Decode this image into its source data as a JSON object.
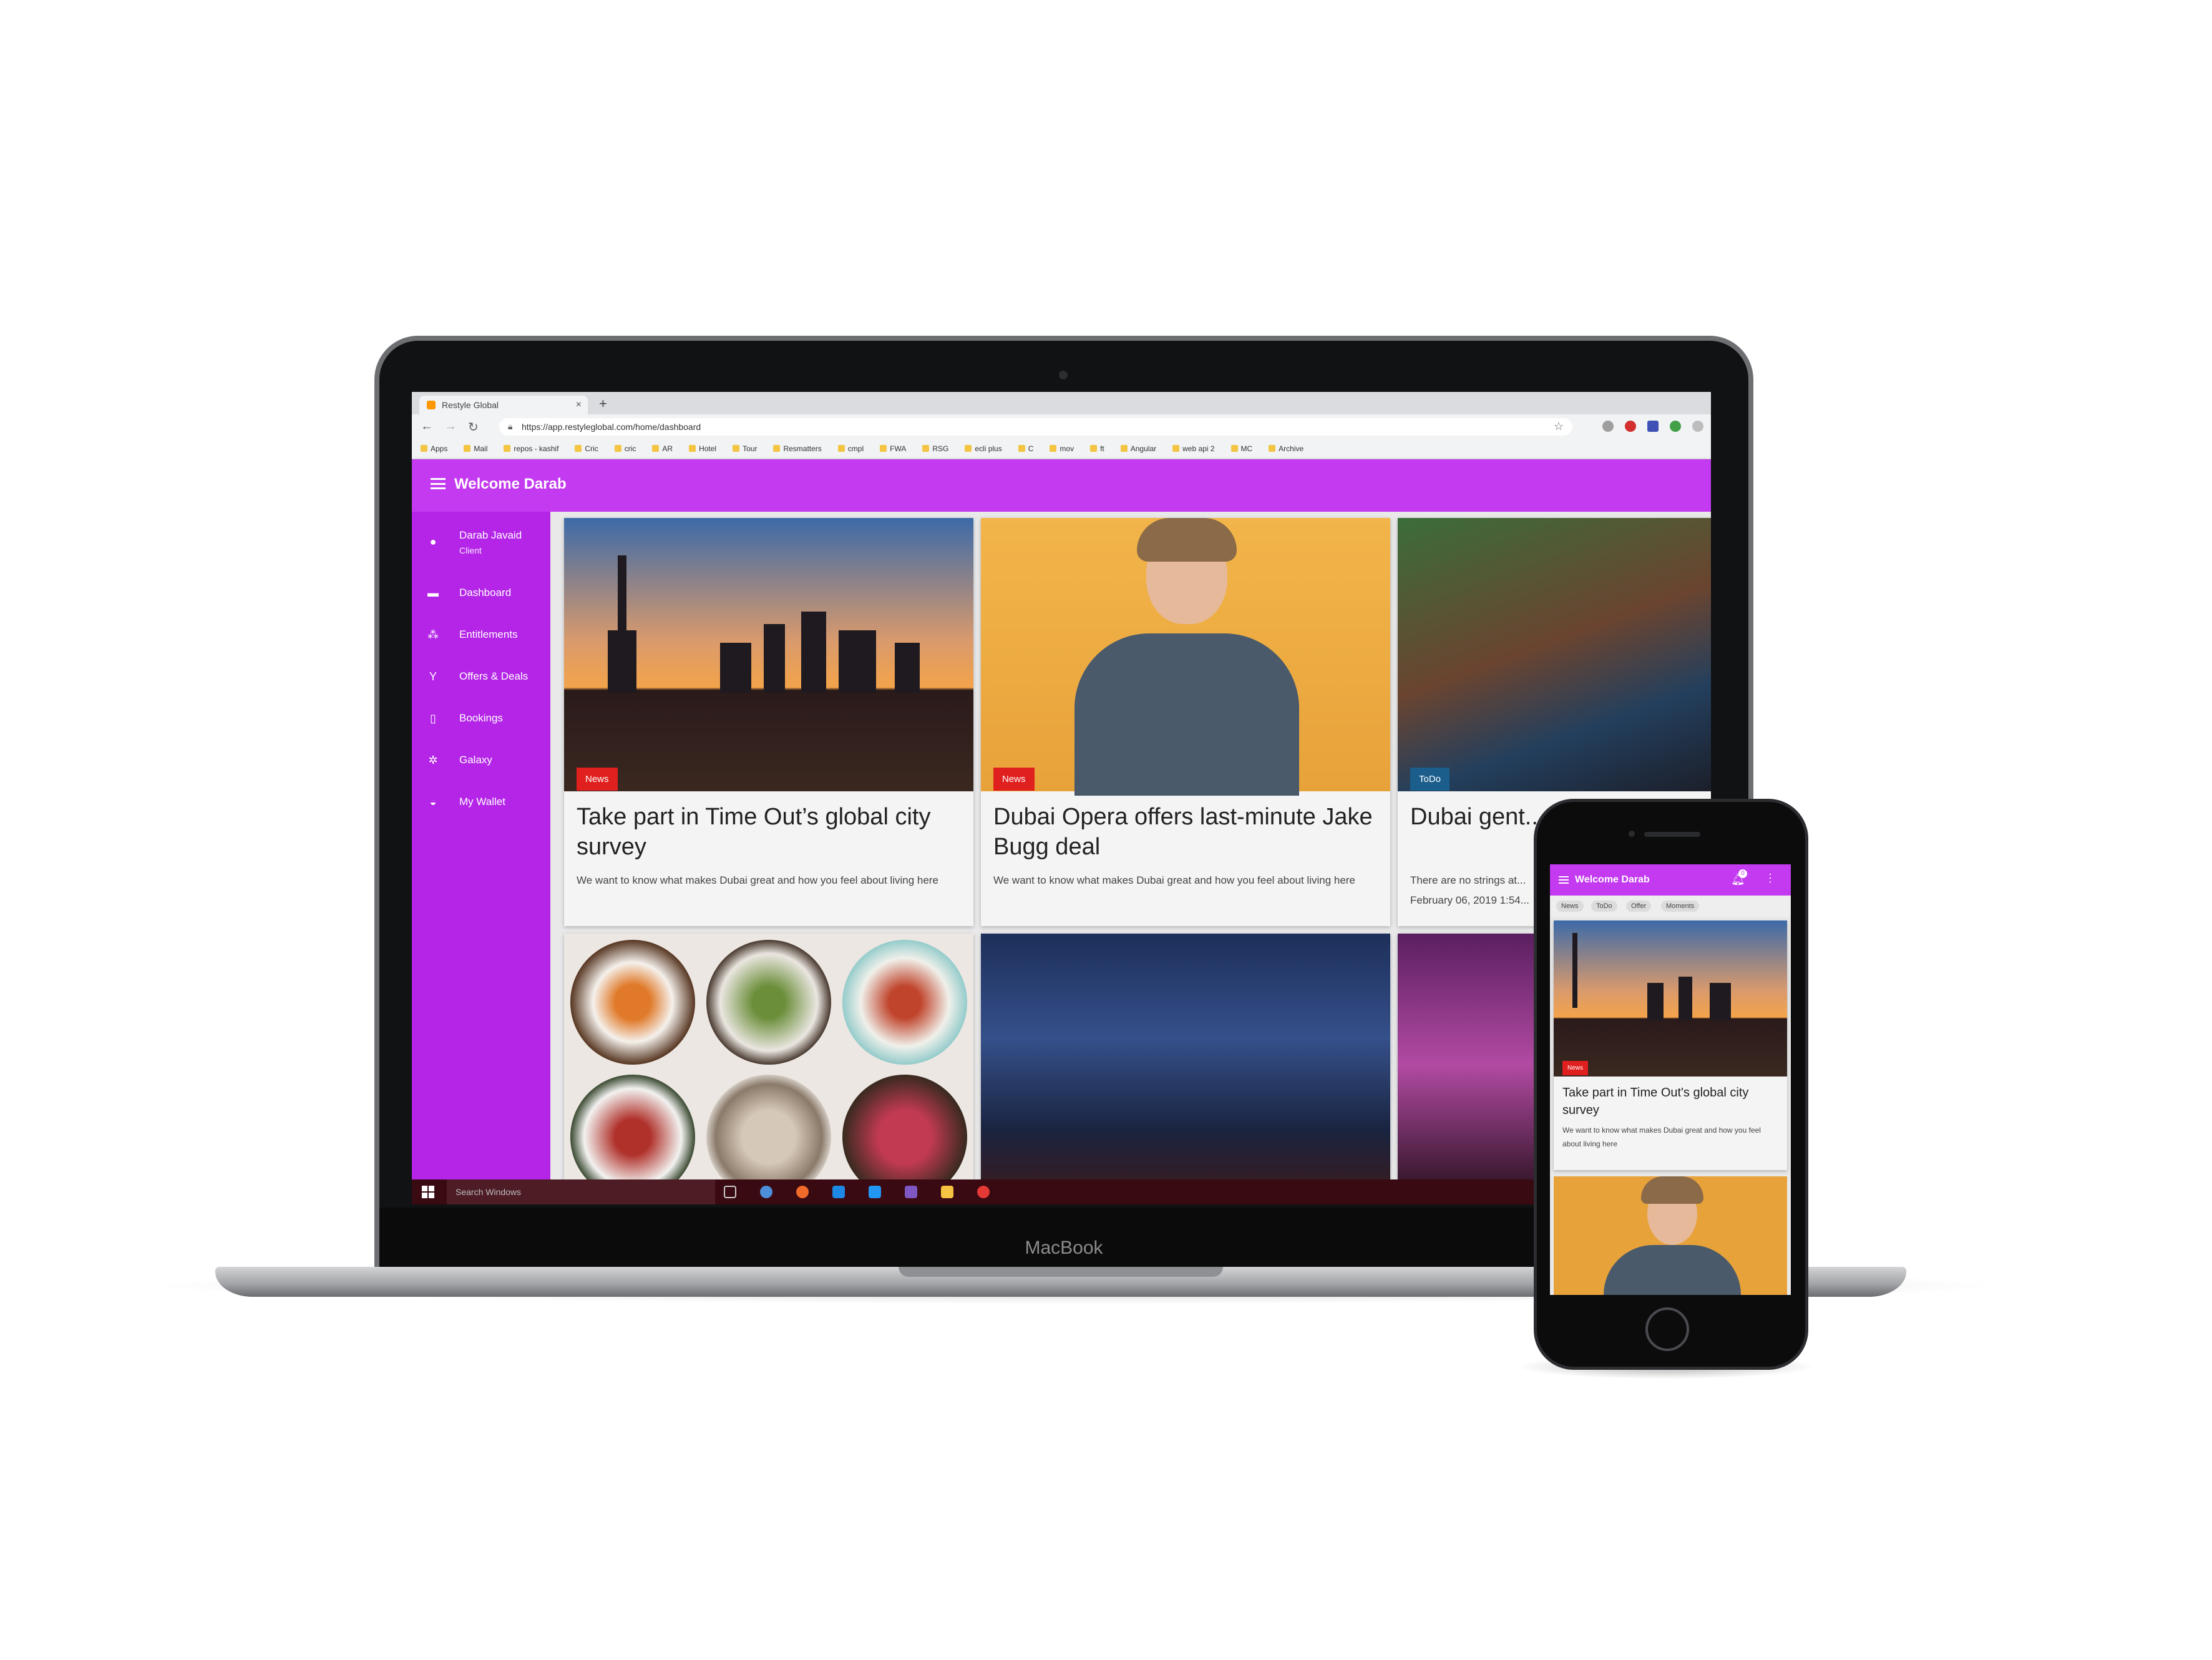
{
  "browser": {
    "tab_title": "Restyle Global",
    "tab_close": "×",
    "new_tab": "+",
    "url": "https://app.restyleglobal.com/home/dashboard",
    "bookmarks": [
      "Apps",
      "Mail",
      "repos - kashif",
      "Cric",
      "cric",
      "AR",
      "Hotel",
      "Tour",
      "Resmatters",
      "cmpl",
      "FWA",
      "RSG",
      "ecli plus",
      "C",
      "mov",
      "ft",
      "Angular",
      "web api 2",
      "MC",
      "Archive"
    ]
  },
  "app": {
    "title": "Welcome Darab",
    "accent_color": "#c33af0",
    "sidebar_color": "#b425e8"
  },
  "sidebar": {
    "user_name": "Darab Javaid",
    "user_role": "Client",
    "items": [
      {
        "label": "Dashboard",
        "icon": "dashboard-icon",
        "glyph": "▬"
      },
      {
        "label": "Entitlements",
        "icon": "entitlements-icon",
        "glyph": "⁂"
      },
      {
        "label": "Offers & Deals",
        "icon": "cocktail-icon",
        "glyph": "Y"
      },
      {
        "label": "Bookings",
        "icon": "bookmark-icon",
        "glyph": "▯"
      },
      {
        "label": "Galaxy",
        "icon": "galaxy-icon",
        "glyph": "✲"
      },
      {
        "label": "My Wallet",
        "icon": "wallet-icon",
        "glyph": "◒"
      }
    ]
  },
  "cards": [
    {
      "badge": "News",
      "badge_color": "#e0201f",
      "title": "Take part in Time Out’s global city survey",
      "desc": "We want to know what makes Dubai great and how you feel about living here"
    },
    {
      "badge": "News",
      "badge_color": "#e0201f",
      "title": "Dubai Opera offers last-minute Jake Bugg deal",
      "desc": "We want to know what makes Dubai great and how you feel about living here"
    },
    {
      "badge": "ToDo",
      "badge_color": "#1b5e8c",
      "title": "Dubai gent... hours of fr...",
      "desc": "There are no strings at...",
      "date": "February 06, 2019 1:54..."
    }
  ],
  "taskbar": {
    "search_placeholder": "Search Windows"
  },
  "device_label": "MacBook",
  "phone": {
    "title": "Welcome Darab",
    "notification_count": "0",
    "chips": [
      "News",
      "ToDo",
      "Offer",
      "Moments"
    ],
    "card": {
      "badge": "News",
      "title": "Take part in Time Out's global city survey",
      "desc": "We want to know what makes Dubai great and how you feel about living here"
    }
  }
}
